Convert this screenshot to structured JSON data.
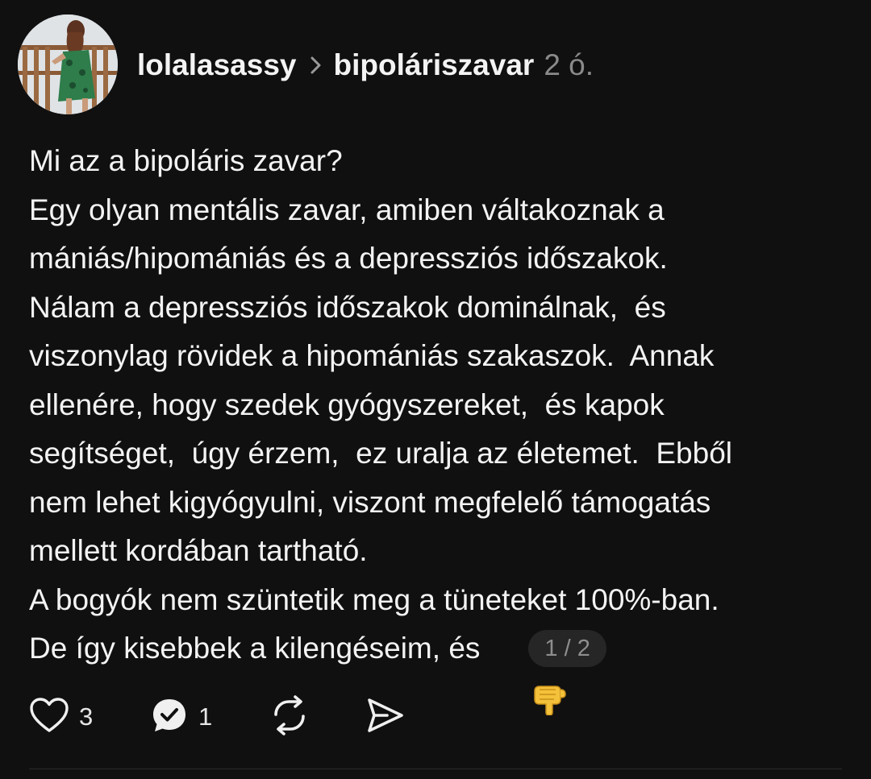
{
  "post": {
    "author": "lolalasassy",
    "topic": "bipoláriszavar",
    "time_ago": "2 ó.",
    "body_lines": [
      "Mi az a bipoláris zavar?",
      "Egy olyan mentális zavar, amiben váltakoznak a",
      "mániás/hipomániás és a depressziós időszakok.",
      "Nálam a depressziós időszakok dominálnak,  és",
      "viszonylag rövidek a hipomániás szakaszok.  Annak",
      "ellenére, hogy szedek gyógyszereket,  és kapok",
      "segítséget,  úgy érzem,  ez uralja az életemet.  Ebből",
      "nem lehet kigyógyulni, viszont megfelelő támogatás",
      "mellett kordában tartható.",
      "A bogyók nem szüntetik meg a tüneteket 100%-ban.",
      "De így kisebbek a kilengéseim, és"
    ],
    "trailing_emoji": "pointing-down-emoji",
    "page_indicator": "1 / 2"
  },
  "actions": {
    "likes": "3",
    "replies": "1"
  },
  "icons": {
    "chevron": "chevron-right-icon",
    "like": "heart-icon",
    "reply": "comment-icon",
    "repost": "repost-icon",
    "share": "send-icon"
  },
  "colors": {
    "background": "#101010",
    "text": "#f3f3f3",
    "muted": "#8a8a8a",
    "pill": "#262626"
  }
}
